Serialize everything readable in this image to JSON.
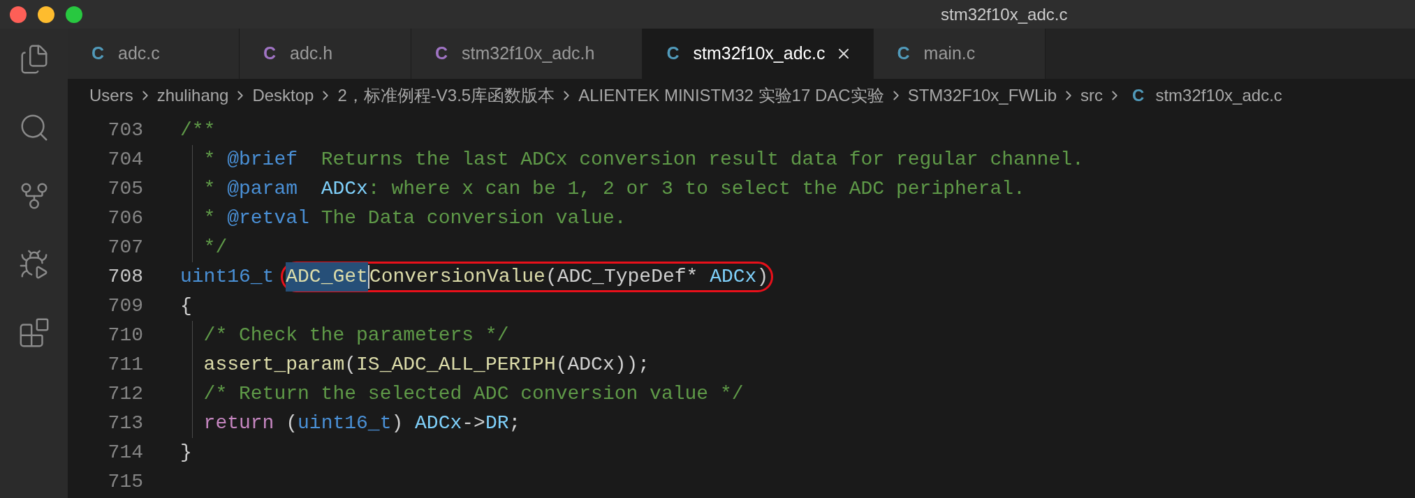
{
  "window": {
    "title": "stm32f10x_adc.c"
  },
  "tabs": [
    {
      "icon": "C",
      "color": "#519aba",
      "label": "adc.c",
      "selected": false
    },
    {
      "icon": "C",
      "color": "#a074c4",
      "label": "adc.h",
      "selected": false
    },
    {
      "icon": "C",
      "color": "#a074c4",
      "label": "stm32f10x_adc.h",
      "selected": false
    },
    {
      "icon": "C",
      "color": "#519aba",
      "label": "stm32f10x_adc.c",
      "selected": true
    },
    {
      "icon": "C",
      "color": "#519aba",
      "label": "main.c",
      "selected": false
    }
  ],
  "breadcrumb": {
    "items": [
      "Users",
      "zhulihang",
      "Desktop",
      "2，标准例程-V3.5库函数版本",
      "ALIENTEK MINISTM32 实验17 DAC实验",
      "STM32F10x_FWLib",
      "src"
    ],
    "file": {
      "icon": "C",
      "color": "#519aba",
      "label": "stm32f10x_adc.c"
    }
  },
  "code": {
    "lines": [
      {
        "number": "703",
        "current": false,
        "tokens": [
          {
            "text": "/**",
            "kind": "comment"
          }
        ]
      },
      {
        "number": "704",
        "current": false,
        "tokens": [
          {
            "kind": "indent"
          },
          {
            "text": "* ",
            "kind": "comment"
          },
          {
            "text": "@brief",
            "kind": "doc_tag"
          },
          {
            "text": "  Returns the last ADCx conversion result data for regular channel.",
            "kind": "comment"
          }
        ]
      },
      {
        "number": "705",
        "current": false,
        "tokens": [
          {
            "kind": "indent"
          },
          {
            "text": "* ",
            "kind": "comment"
          },
          {
            "text": "@param  ",
            "kind": "doc_tag"
          },
          {
            "text": "ADCx",
            "kind": "variable"
          },
          {
            "text": ": where x can be 1, 2 or 3 to select the ADC peripheral.",
            "kind": "comment"
          }
        ]
      },
      {
        "number": "706",
        "current": false,
        "tokens": [
          {
            "kind": "indent"
          },
          {
            "text": "* ",
            "kind": "comment"
          },
          {
            "text": "@retval",
            "kind": "doc_tag"
          },
          {
            "text": " The Data conversion value.",
            "kind": "comment"
          }
        ]
      },
      {
        "number": "707",
        "current": false,
        "tokens": [
          {
            "kind": "indent"
          },
          {
            "text": "*/",
            "kind": "comment"
          }
        ]
      },
      {
        "number": "708",
        "current": true,
        "tokens": [
          {
            "text": "uint16_t ",
            "kind": "type"
          },
          {
            "kind": "circled",
            "cursor": true,
            "tokens": [
              {
                "text": "ADC_Get",
                "kind": "function",
                "selected": true
              },
              {
                "text": "ConversionValue",
                "kind": "function",
                "selected": false
              },
              {
                "text": "(ADC_TypeDef* ",
                "kind": "plain",
                "selected": false
              },
              {
                "text": "ADCx",
                "kind": "variable",
                "selected": false
              },
              {
                "text": ")",
                "kind": "plain",
                "selected": false
              }
            ]
          }
        ]
      },
      {
        "number": "709",
        "current": false,
        "tokens": [
          {
            "text": "{",
            "kind": "plain"
          }
        ]
      },
      {
        "number": "710",
        "current": false,
        "tokens": [
          {
            "kind": "indent"
          },
          {
            "text": "/* Check the parameters */",
            "kind": "comment"
          }
        ]
      },
      {
        "number": "711",
        "current": false,
        "tokens": [
          {
            "kind": "indent"
          },
          {
            "text": "assert_param",
            "kind": "function"
          },
          {
            "text": "(",
            "kind": "plain"
          },
          {
            "text": "IS_ADC_ALL_PERIPH",
            "kind": "function"
          },
          {
            "text": "(ADCx));",
            "kind": "plain"
          }
        ]
      },
      {
        "number": "712",
        "current": false,
        "tokens": [
          {
            "kind": "indent"
          },
          {
            "text": "/* Return the selected ADC conversion value */",
            "kind": "comment"
          }
        ]
      },
      {
        "number": "713",
        "current": false,
        "tokens": [
          {
            "kind": "indent"
          },
          {
            "text": "return",
            "kind": "keyword"
          },
          {
            "text": " (",
            "kind": "plain"
          },
          {
            "text": "uint16_t",
            "kind": "type"
          },
          {
            "text": ") ",
            "kind": "plain"
          },
          {
            "text": "ADCx",
            "kind": "variable"
          },
          {
            "text": "->",
            "kind": "plain"
          },
          {
            "text": "DR",
            "kind": "variable"
          },
          {
            "text": ";",
            "kind": "plain"
          }
        ]
      },
      {
        "number": "714",
        "current": false,
        "tokens": [
          {
            "text": "}",
            "kind": "plain"
          }
        ]
      },
      {
        "number": "715",
        "current": false
      }
    ]
  }
}
